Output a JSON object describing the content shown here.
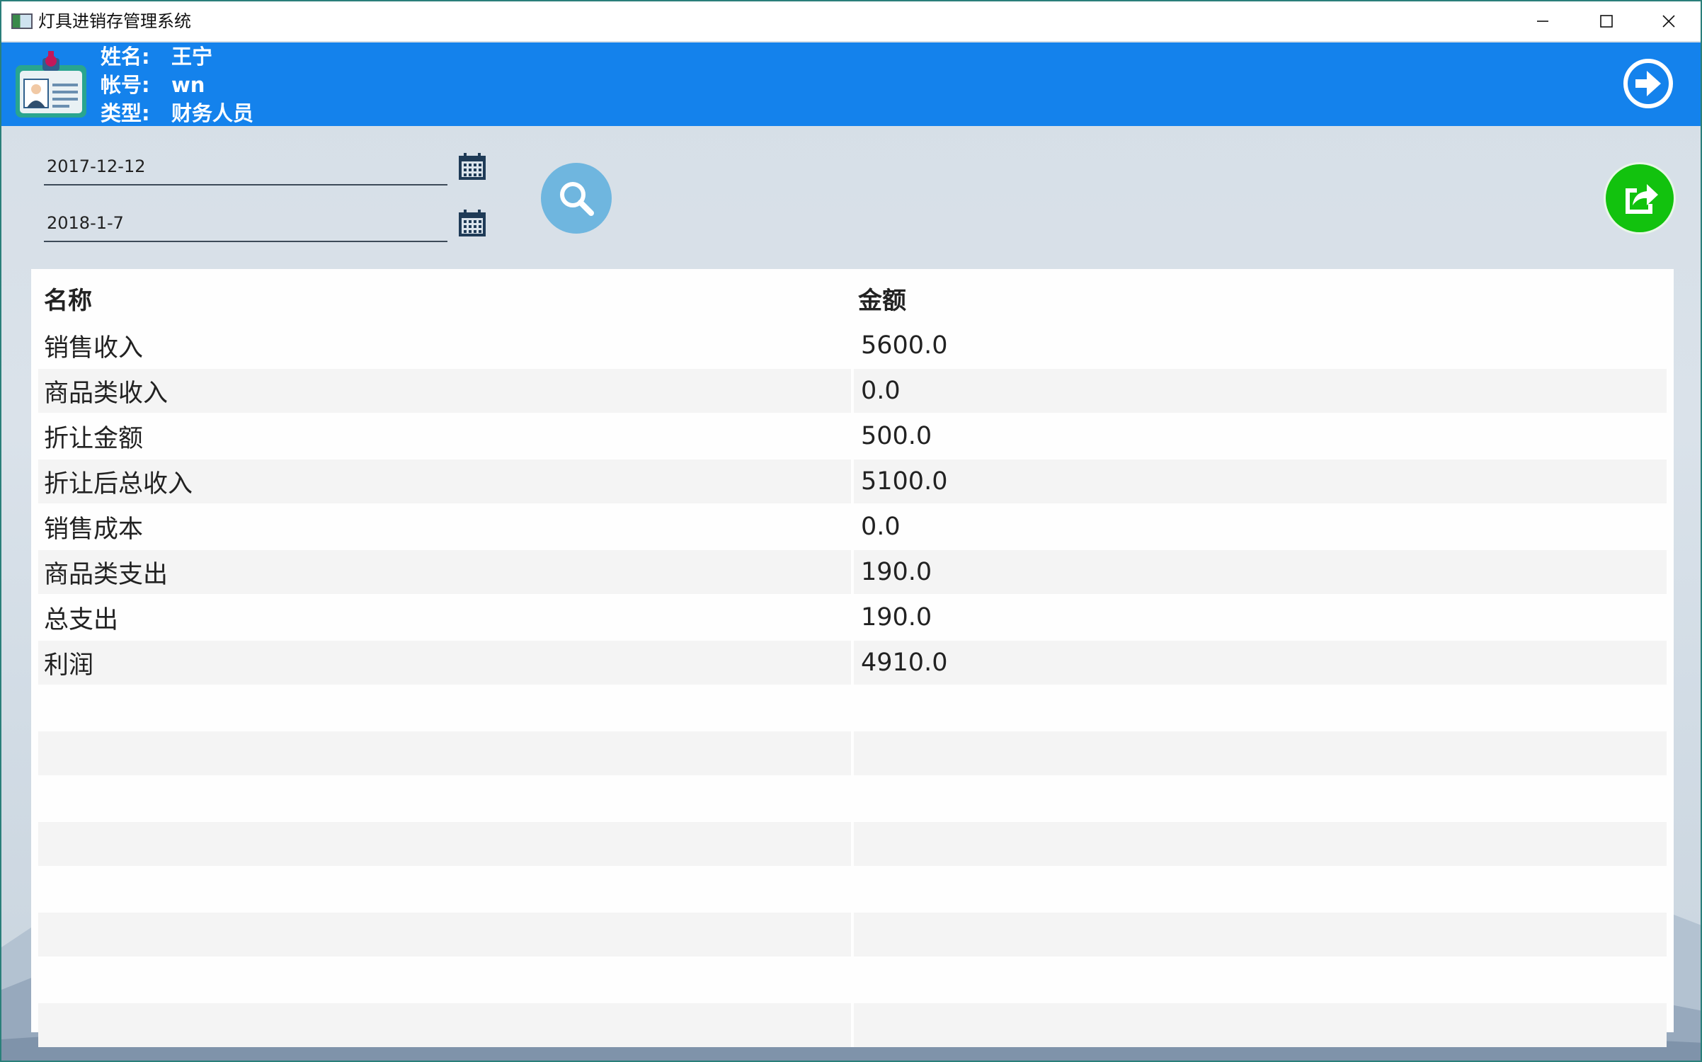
{
  "window": {
    "title": "灯具进销存管理系统"
  },
  "user": {
    "name_label": "姓名:",
    "name_value": "王宁",
    "account_label": "帐号:",
    "account_value": "wn",
    "type_label": "类型:",
    "type_value": "财务人员"
  },
  "filters": {
    "start_date": "2017-12-12",
    "end_date": "2018-1-7"
  },
  "table": {
    "columns": [
      "名称",
      "金额"
    ],
    "rows": [
      {
        "name": "销售收入",
        "amount": "5600.0"
      },
      {
        "name": "商品类收入",
        "amount": "0.0"
      },
      {
        "name": "折让金额",
        "amount": "500.0"
      },
      {
        "name": "折让后总收入",
        "amount": "5100.0"
      },
      {
        "name": "销售成本",
        "amount": "0.0"
      },
      {
        "name": "商品类支出",
        "amount": "190.0"
      },
      {
        "name": "总支出",
        "amount": "190.0"
      },
      {
        "name": "利润",
        "amount": "4910.0"
      },
      {
        "name": "",
        "amount": ""
      },
      {
        "name": "",
        "amount": ""
      },
      {
        "name": "",
        "amount": ""
      },
      {
        "name": "",
        "amount": ""
      },
      {
        "name": "",
        "amount": ""
      },
      {
        "name": "",
        "amount": ""
      },
      {
        "name": "",
        "amount": ""
      },
      {
        "name": "",
        "amount": ""
      },
      {
        "name": "",
        "amount": ""
      }
    ]
  },
  "colors": {
    "header_blue": "#1482ec",
    "search_button": "#6fb6df",
    "export_button": "#12c20e"
  },
  "icons": {
    "app": "app-icon",
    "user_card": "id-card-icon",
    "logout": "arrow-circle-right-icon",
    "calendar": "calendar-icon",
    "search": "search-icon",
    "export": "share-export-icon"
  }
}
